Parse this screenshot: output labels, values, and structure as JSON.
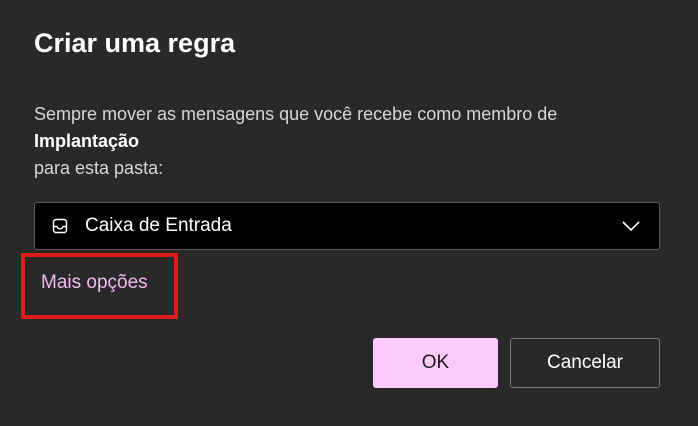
{
  "dialog": {
    "title": "Criar uma regra",
    "description": {
      "line1": "Sempre mover as mensagens que você recebe como membro de",
      "group_name": "Implantação",
      "line3": "para esta pasta:"
    },
    "folder_select": {
      "icon": "inbox-icon",
      "value": "Caixa de Entrada",
      "chevron": "chevron-down-icon"
    },
    "more_options_label": "Mais opções",
    "buttons": {
      "ok_label": "OK",
      "cancel_label": "Cancelar"
    },
    "colors": {
      "background": "#292929",
      "accent": "#fccbfc",
      "link": "#f2b9f2",
      "highlight_frame": "#e01b1b"
    }
  }
}
